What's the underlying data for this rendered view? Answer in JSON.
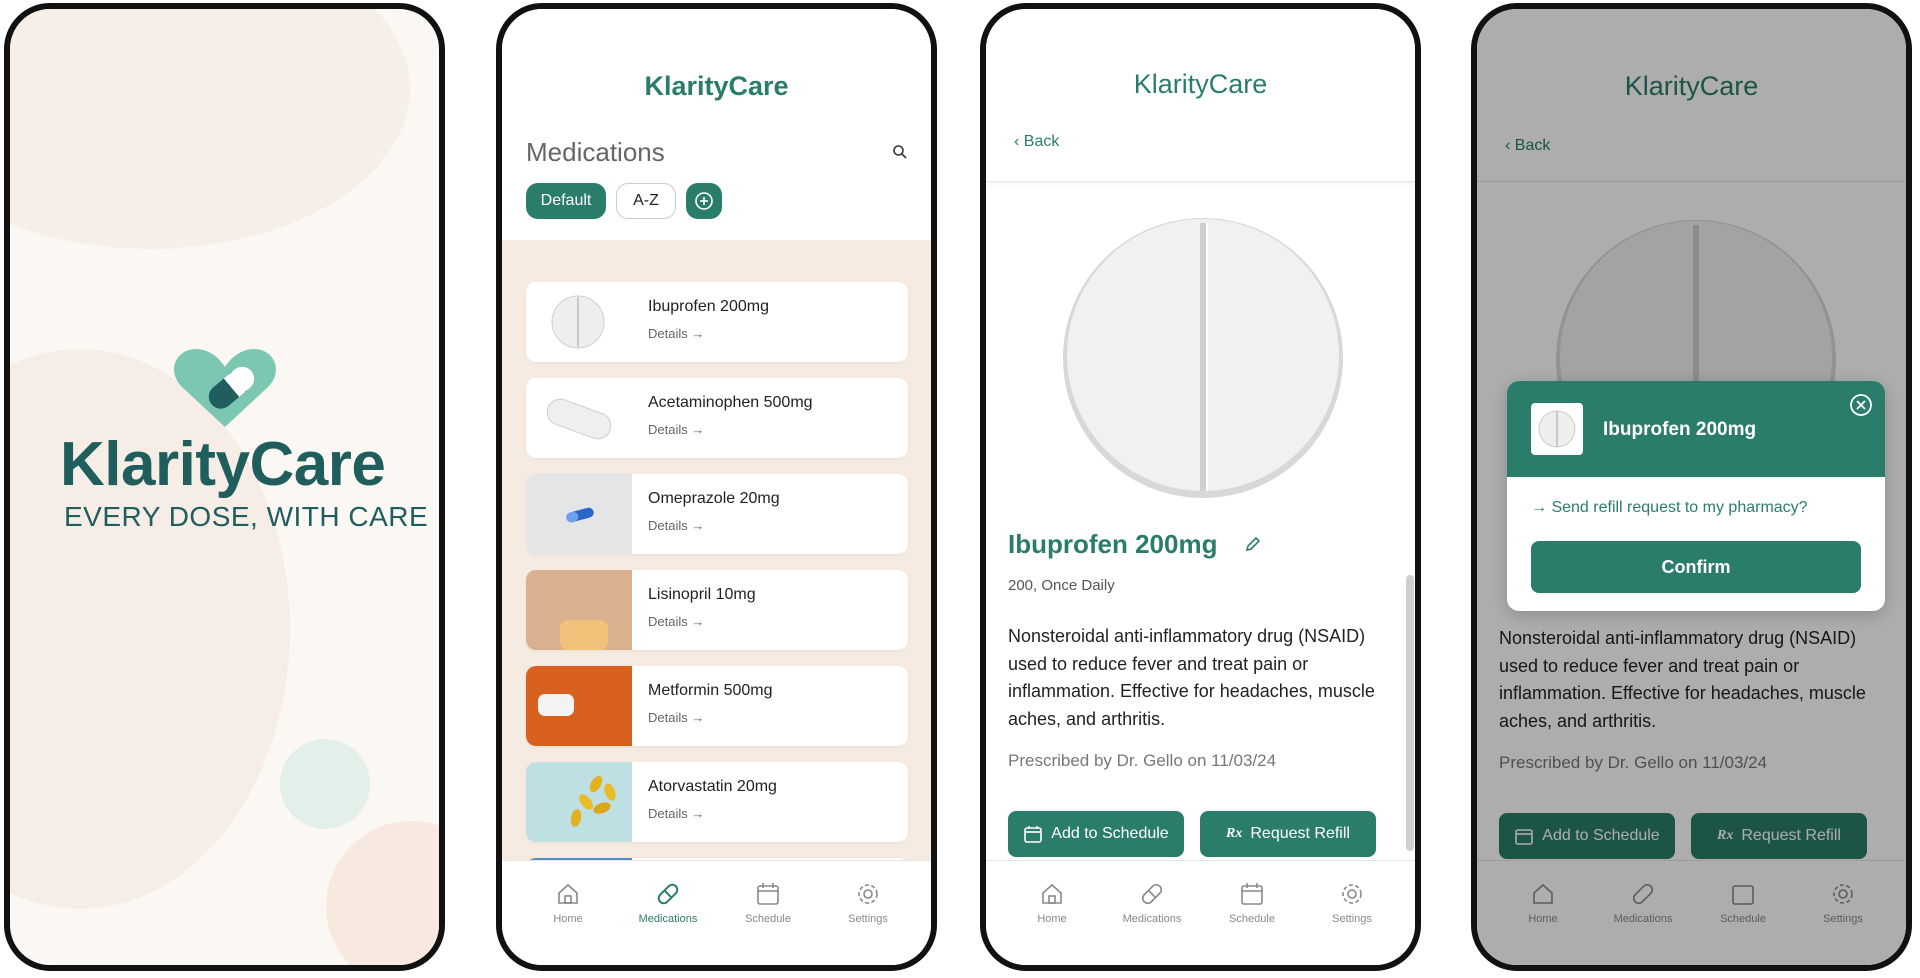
{
  "brand": "KlarityCare",
  "colors": {
    "accent": "#2a7d6b",
    "brand_dark": "#1f5e5c",
    "list_bg": "#f6ebe1"
  },
  "splash": {
    "logo_word": "KlarityCare",
    "tagline": "EVERY DOSE, WITH CARE"
  },
  "list_screen": {
    "title": "KlarityCare",
    "heading": "Medications",
    "chips": {
      "default": "Default",
      "az": "A-Z"
    },
    "items": [
      {
        "name": "Ibuprofen 200mg",
        "details": "Details →"
      },
      {
        "name": "Acetaminophen 500mg",
        "details": "Details →"
      },
      {
        "name": "Omeprazole 20mg",
        "details": "Details →"
      },
      {
        "name": "Lisinopril 10mg",
        "details": "Details →"
      },
      {
        "name": "Metformin 500mg",
        "details": "Details →"
      },
      {
        "name": "Atorvastatin 20mg",
        "details": "Details →"
      }
    ]
  },
  "nav": {
    "home": "Home",
    "medications": "Medications",
    "schedule": "Schedule",
    "settings": "Settings"
  },
  "detail": {
    "title": "KlarityCare",
    "back": "Back",
    "med_name": "Ibuprofen 200mg",
    "dosage": "200, Once Daily",
    "description": "Nonsteroidal anti-inflammatory drug (NSAID) used to reduce fever and treat pain or inflammation. Effective for headaches, muscle aches, and arthritis.",
    "prescribed": "Prescribed by Dr. Gello on 11/03/24",
    "add_schedule": "Add to Schedule",
    "request_refill": "Request Refill",
    "rx_symbol": "Rx"
  },
  "refill_modal": {
    "med_name": "Ibuprofen 200mg",
    "prompt": "Send refill request to my pharmacy?",
    "confirm": "Confirm"
  },
  "icons": [
    "search-icon",
    "add-circle-icon",
    "home-icon",
    "pill-icon",
    "calendar-icon",
    "gear-icon",
    "chevron-left-icon",
    "pencil-icon",
    "close-circle-icon",
    "arrow-right-icon",
    "heart-pill-logo"
  ]
}
